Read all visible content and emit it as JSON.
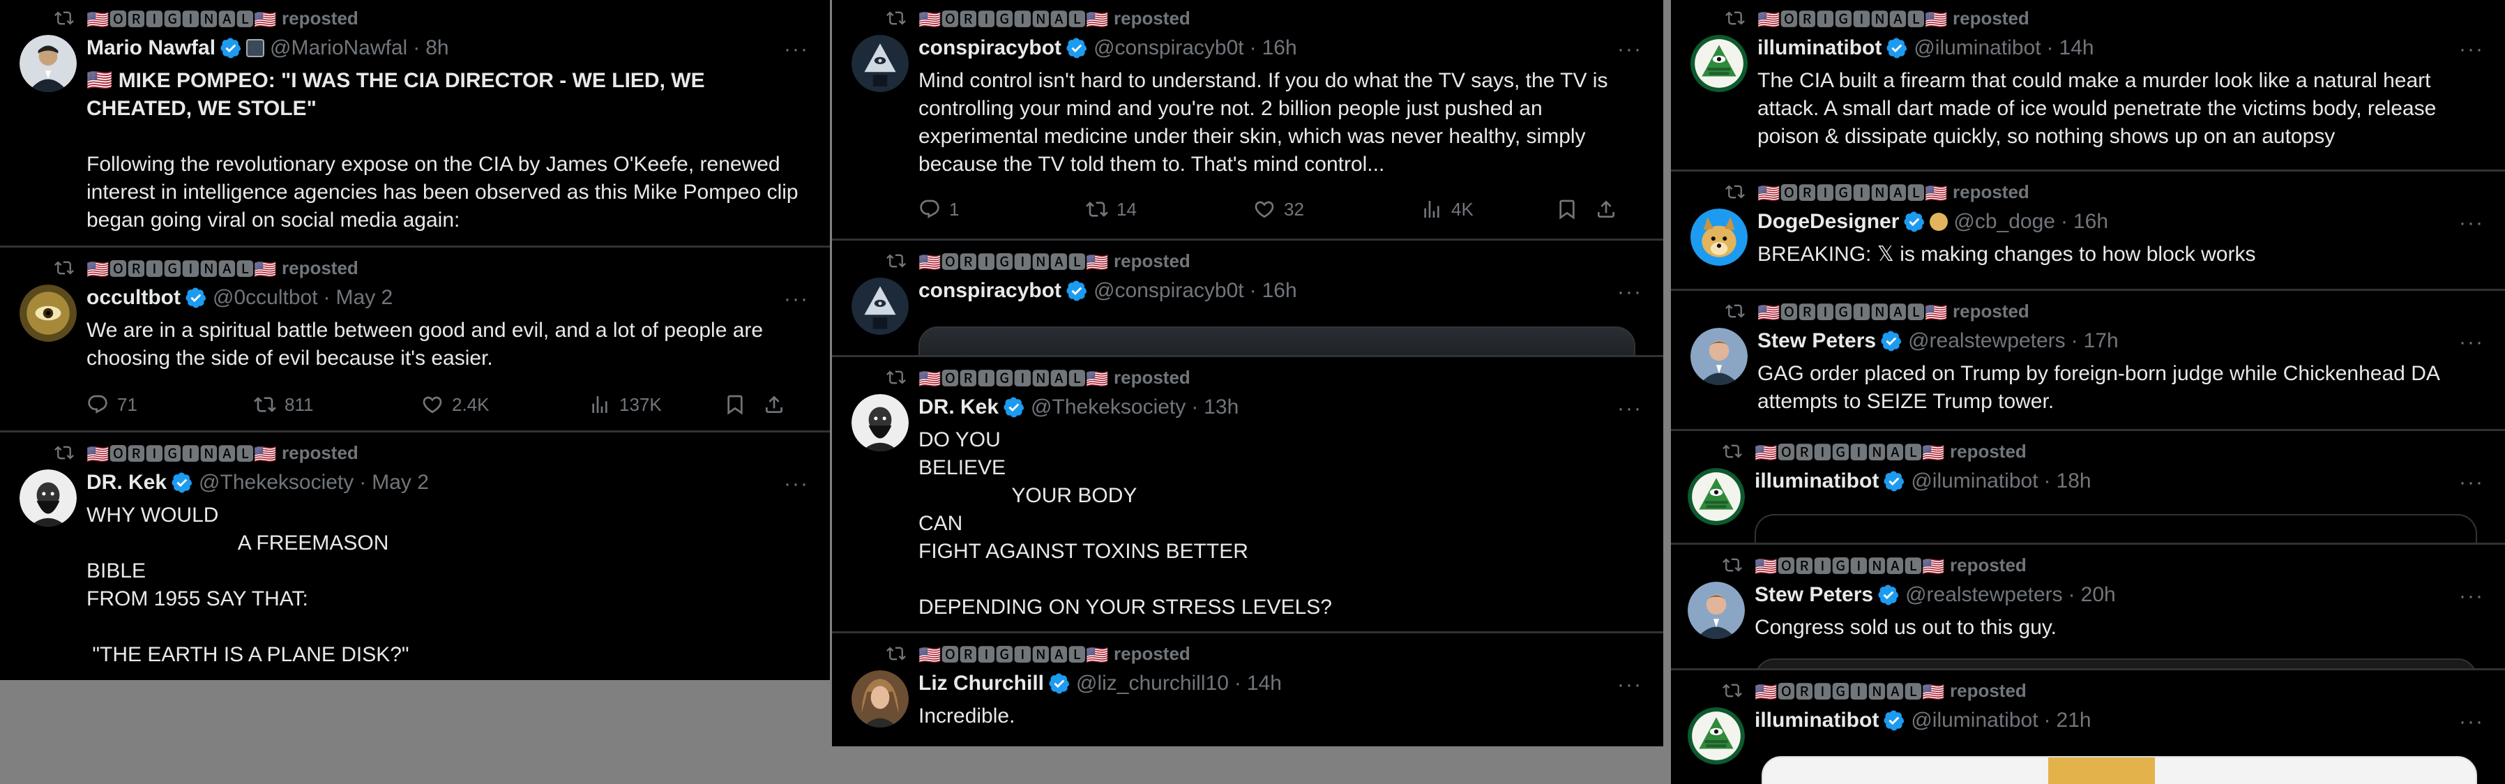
{
  "common": {
    "repost_prefix": "🇺🇸🅾🆁🅸🅶🅸🅽🅰🅻🇺🇸",
    "repost_label": "reposted",
    "more_label": "···"
  },
  "colors": {
    "verified": "#1d9bf0",
    "muted": "#71767b",
    "text": "#e7e9ea",
    "background": "#000000",
    "divider": "#2f3336"
  },
  "icons": [
    "repost-icon",
    "verified-badge-icon",
    "more-icon",
    "reply-icon",
    "like-icon",
    "views-icon",
    "bookmark-icon",
    "share-icon",
    "flag-icon"
  ],
  "columns": [
    {
      "tweets": [
        {
          "name": "Mario Nawfal",
          "handle": "@MarioNawfal",
          "time": "8h",
          "headline": "🇺🇸 MIKE POMPEO: \"I WAS THE CIA DIRECTOR - WE LIED, WE CHEATED, WE STOLE\"",
          "body": "Following the revolutionary expose on the CIA by James O'Keefe, renewed interest in intelligence agencies has been observed as this Mike Pompeo clip began going viral on social media again:"
        },
        {
          "name": "occultbot",
          "handle": "@0ccultbot",
          "time": "May 2",
          "body": "We are in a spiritual battle between good and evil, and a lot of people are choosing the side of evil because it's easier.",
          "stats": {
            "replies": "71",
            "reposts": "811",
            "likes": "2.4K",
            "views": "137K"
          }
        },
        {
          "name": "DR. Kek",
          "handle": "@Thekeksociety",
          "time": "May 2",
          "body": "WHY WOULD\n                          A FREEMASON\nBIBLE\nFROM 1955 SAY THAT:\n\n \"THE EARTH IS A PLANE DISK?\""
        }
      ]
    },
    {
      "tweets": [
        {
          "name": "conspiracybot",
          "handle": "@conspiracyb0t",
          "time": "16h",
          "body": "Mind control isn't hard to understand. If you do what the TV says, the TV is controlling your mind and you're not. 2 billion people just pushed an experimental medicine under their skin, which was never healthy, simply because the TV told them to. That's mind control...",
          "stats": {
            "replies": "1",
            "reposts": "14",
            "likes": "32",
            "views": "4K"
          }
        },
        {
          "name": "conspiracybot",
          "handle": "@conspiracyb0t",
          "time": "16h",
          "body": ""
        },
        {
          "name": "DR. Kek",
          "handle": "@Thekeksociety",
          "time": "13h",
          "body": "DO YOU\nBELIEVE\n                YOUR BODY\nCAN\nFIGHT AGAINST TOXINS BETTER\n\nDEPENDING ON YOUR STRESS LEVELS?"
        },
        {
          "name": "Liz Churchill",
          "handle": "@liz_churchill10",
          "time": "14h",
          "body": "Incredible."
        }
      ]
    },
    {
      "tweets": [
        {
          "name": "illuminatibot",
          "handle": "@iluminatibot",
          "time": "14h",
          "body": "The CIA built a firearm that could make a murder look like a natural heart attack. A small dart made of ice would penetrate the victims body, release poison & dissipate quickly, so nothing shows up on an autopsy"
        },
        {
          "name": "DogeDesigner",
          "handle": "@cb_doge",
          "time": "16h",
          "body": "BREAKING: 𝕏 is making changes to how block works"
        },
        {
          "name": "Stew Peters",
          "handle": "@realstewpeters",
          "time": "17h",
          "body": "GAG order placed on Trump by foreign-born judge while Chickenhead DA attempts to SEIZE Trump tower."
        },
        {
          "name": "illuminatibot",
          "handle": "@iluminatibot",
          "time": "18h",
          "body": ""
        },
        {
          "name": "Stew Peters",
          "handle": "@realstewpeters",
          "time": "20h",
          "body": "Congress sold us out to this guy."
        },
        {
          "name": "illuminatibot",
          "handle": "@iluminatibot",
          "time": "21h",
          "body": ""
        }
      ]
    }
  ]
}
